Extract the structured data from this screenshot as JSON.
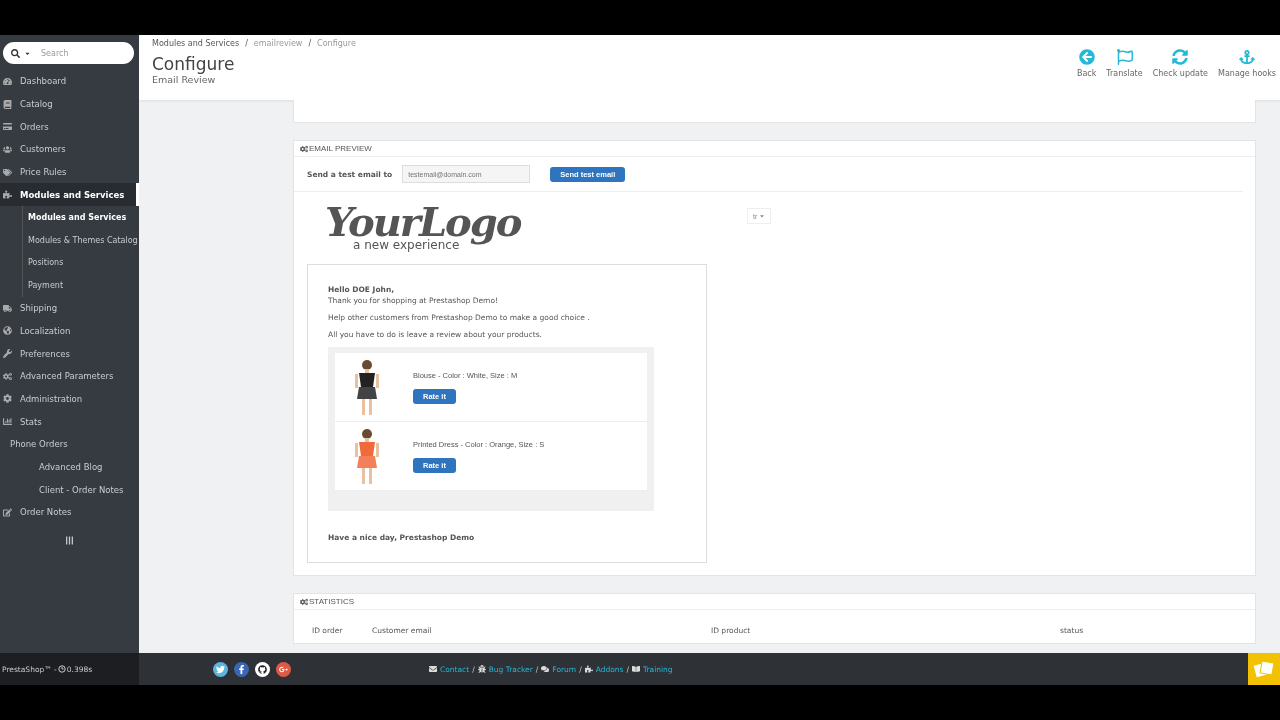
{
  "search": {
    "placeholder": "Search"
  },
  "sidebar": {
    "items": [
      {
        "label": "Dashboard",
        "selected": false
      },
      {
        "label": "Catalog",
        "selected": false
      },
      {
        "label": "Orders",
        "selected": false
      },
      {
        "label": "Customers",
        "selected": false
      },
      {
        "label": "Price Rules",
        "selected": false
      },
      {
        "label": "Modules and Services",
        "selected": true,
        "children": [
          {
            "label": "Modules and Services",
            "selected": true
          },
          {
            "label": "Modules & Themes Catalog",
            "selected": false
          },
          {
            "label": "Positions",
            "selected": false
          },
          {
            "label": "Payment",
            "selected": false
          }
        ]
      },
      {
        "label": "Shipping",
        "selected": false
      },
      {
        "label": "Localization",
        "selected": false
      },
      {
        "label": "Preferences",
        "selected": false
      },
      {
        "label": "Advanced Parameters",
        "selected": false
      },
      {
        "label": "Administration",
        "selected": false
      },
      {
        "label": "Stats",
        "selected": false
      },
      {
        "label": "Phone Orders",
        "selected": false
      },
      {
        "label": "Advanced Blog",
        "selected": false
      },
      {
        "label": "Client - Order Notes",
        "selected": false
      },
      {
        "label": "Order Notes",
        "selected": false
      }
    ]
  },
  "breadcrumb": {
    "separator": "/",
    "items": [
      "Modules and Services",
      "emailreview",
      "Configure"
    ]
  },
  "page": {
    "title": "Configure",
    "subtitle": "Email Review"
  },
  "toolbar": [
    "Back",
    "Translate",
    "Check update",
    "Manage hooks"
  ],
  "email_preview": {
    "title": "EMAIL PREVIEW",
    "test_label": "Send a test email to",
    "test_field": {
      "placeholder": "testemail@domain.com"
    },
    "send_button": "Send test email",
    "language": "tr",
    "logo": {
      "title": "YourLogo",
      "tagline": "a new experience"
    },
    "greeting": "Hello DOE John,",
    "lines": [
      "Thank you for shopping at Prestashop Demo!",
      "Help other customers from Prestashop Demo to make a good choice .",
      "All you have to do is leave a review about your products."
    ],
    "products": [
      {
        "name": "Blouse - Color : White, Size : M",
        "button": "Rate it",
        "color": "#222222"
      },
      {
        "name": "Printed Dress - Color : Orange, Size : S",
        "button": "Rate it",
        "color": "#f06a3c"
      }
    ],
    "closing": "Have a nice day, Prestashop Demo"
  },
  "statistics": {
    "title": "STATISTICS",
    "columns": [
      "ID order",
      "Customer email",
      "ID product",
      "status"
    ]
  },
  "footer": {
    "version": "PrestaShop™ - ",
    "time": "0.398s",
    "separator": "/",
    "links": [
      "Contact",
      "Bug Tracker",
      "Forum",
      "Addons",
      "Training"
    ]
  }
}
